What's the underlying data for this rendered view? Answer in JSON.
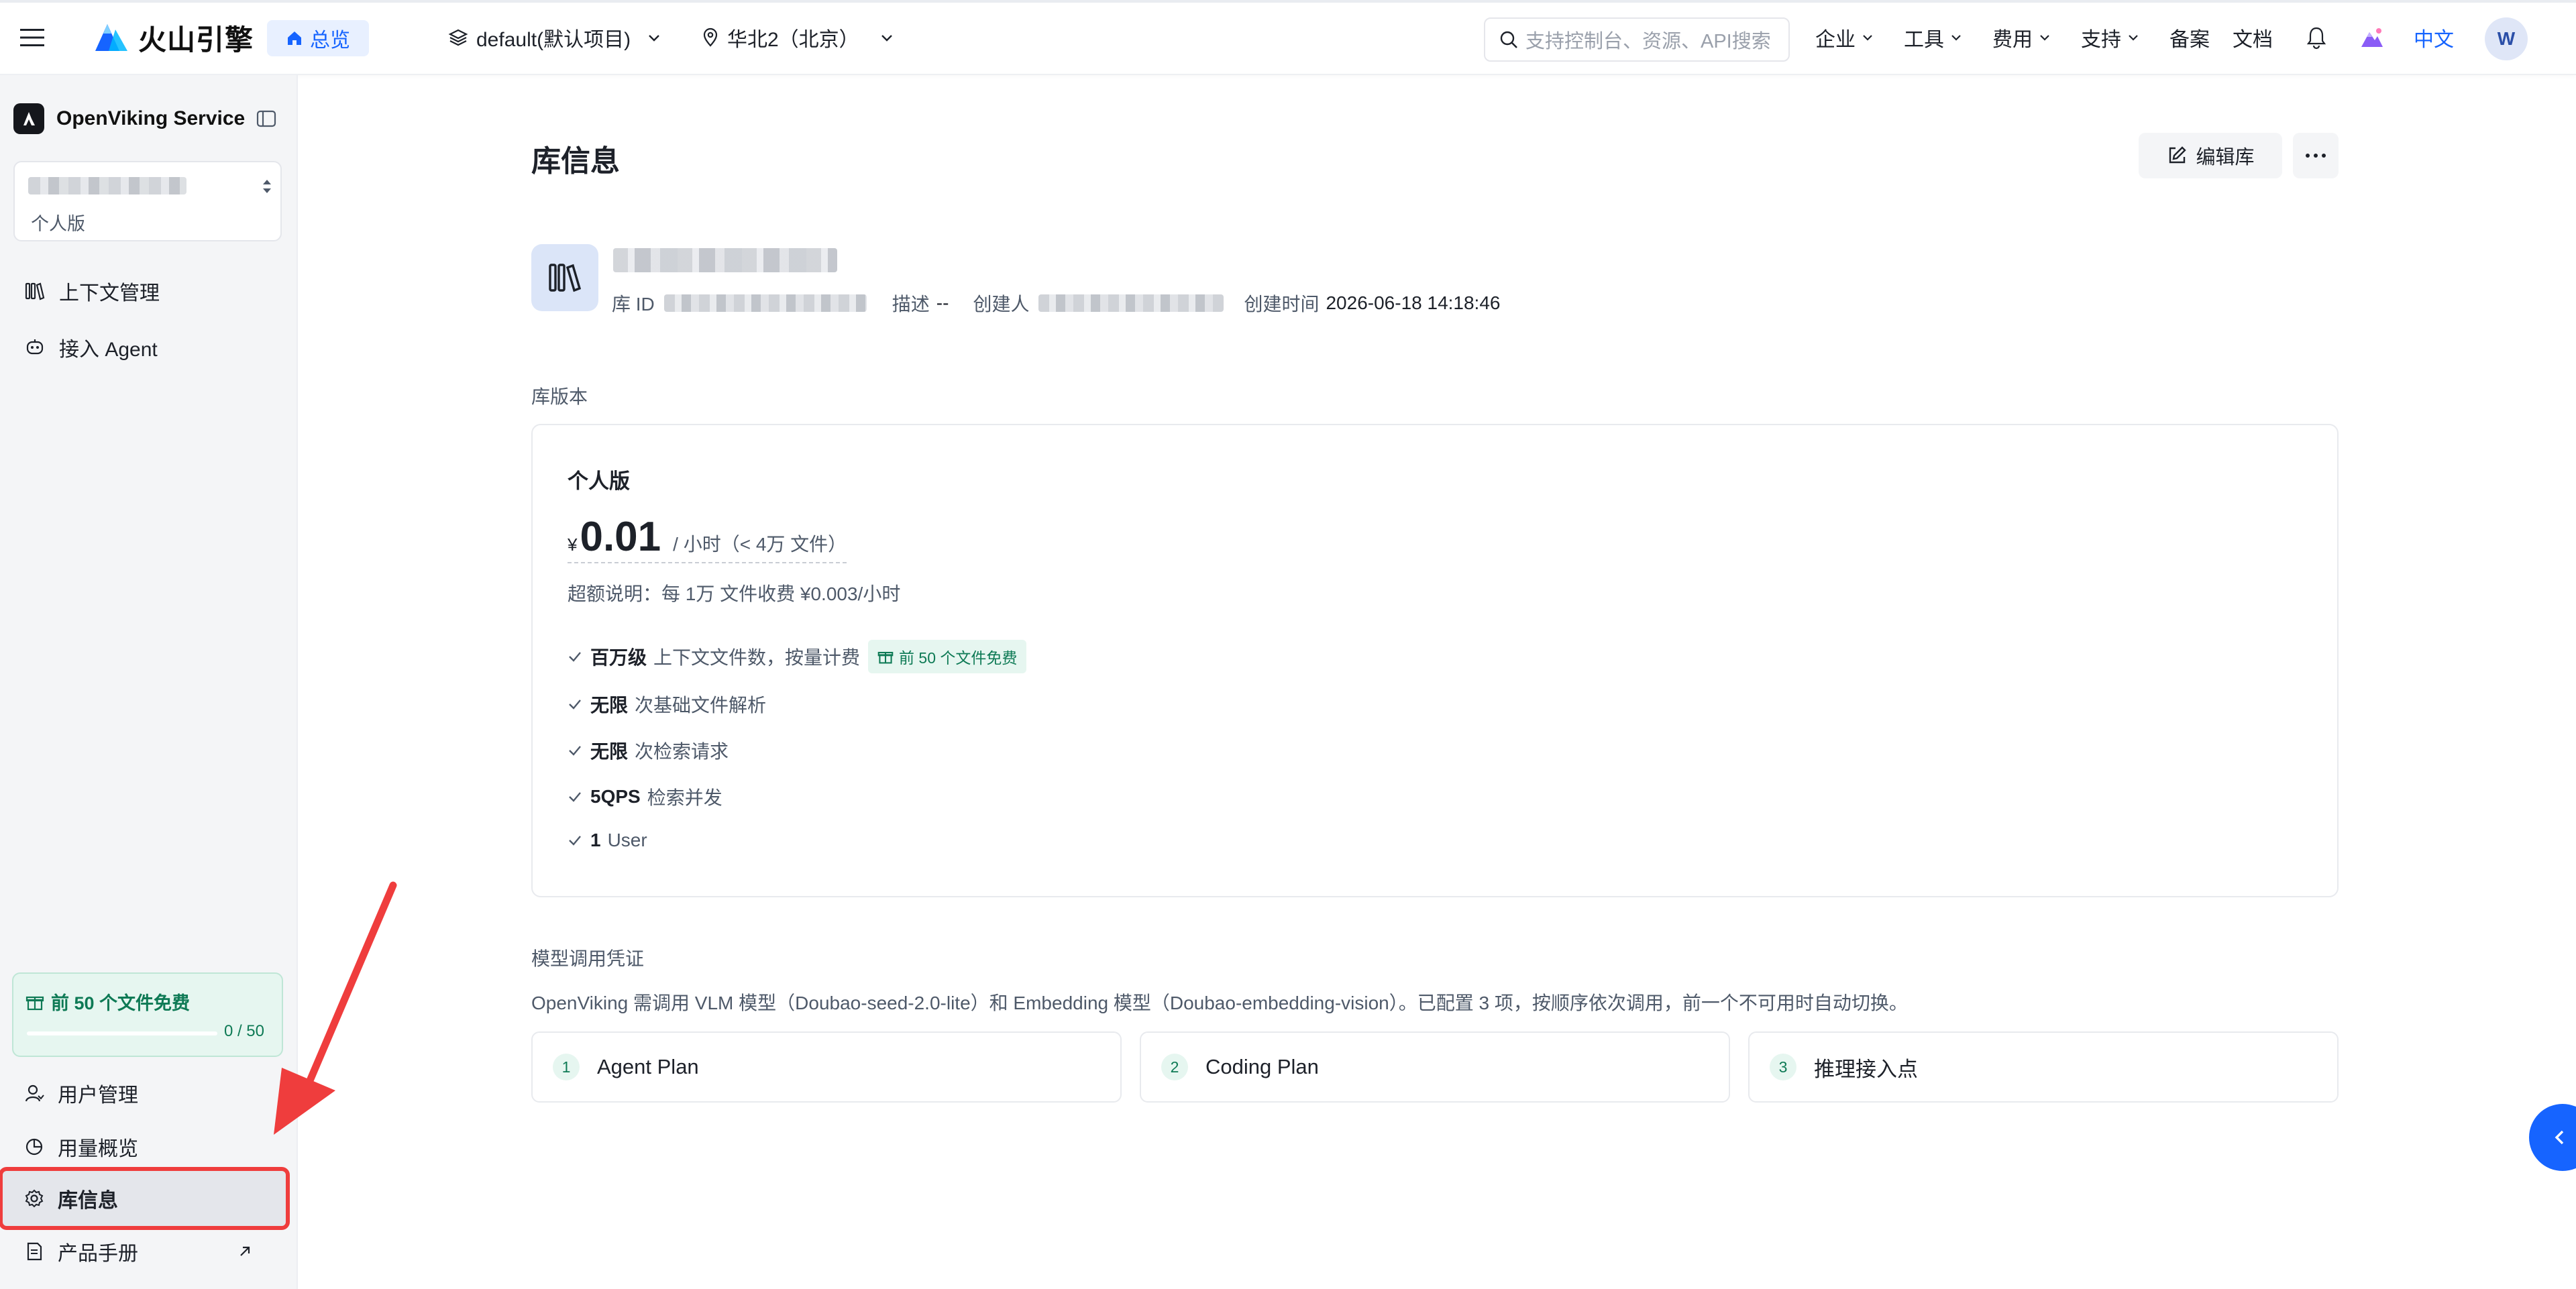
{
  "topbar": {
    "brand": "火山引擎",
    "overview": "总览",
    "project": "default(默认项目)",
    "region": "华北2（北京）",
    "search_placeholder": "支持控制台、资源、API搜索",
    "nav": [
      {
        "label": "企业",
        "has_dropdown": true
      },
      {
        "label": "工具",
        "has_dropdown": true
      },
      {
        "label": "费用",
        "has_dropdown": true
      },
      {
        "label": "支持",
        "has_dropdown": true
      },
      {
        "label": "备案",
        "has_dropdown": false
      },
      {
        "label": "文档",
        "has_dropdown": false
      }
    ],
    "language": "中文",
    "avatar_initial": "W"
  },
  "sidebar": {
    "service_name": "OpenViking Service",
    "workspace_plan": "个人版",
    "items_top": [
      {
        "label": "上下文管理",
        "icon": "library-icon"
      },
      {
        "label": "接入 Agent",
        "icon": "agent-icon"
      }
    ],
    "free_card": {
      "title": "前 50 个文件免费",
      "count": "0 / 50",
      "progress": 0
    },
    "items_bottom": [
      {
        "label": "用户管理",
        "icon": "user-icon"
      },
      {
        "label": "用量概览",
        "icon": "chart-icon"
      },
      {
        "label": "库信息",
        "icon": "gear-icon",
        "active": true
      },
      {
        "label": "产品手册",
        "icon": "doc-icon",
        "external": true
      }
    ]
  },
  "main": {
    "page_title": "库信息",
    "edit_button": "编辑库",
    "library": {
      "id_label": "库 ID",
      "desc_label": "描述",
      "desc_value": "--",
      "creator_label": "创建人",
      "created_label": "创建时间",
      "created_value": "2026-06-18 14:18:46"
    },
    "edition_section_label": "库版本",
    "plan": {
      "name": "个人版",
      "currency": "¥",
      "price": "0.01",
      "unit": "/ 小时（< 4万 文件）",
      "overage": "超额说明：每 1万 文件收费 ¥0.003/小时",
      "features": [
        {
          "bold": "百万级",
          "text": "上下文文件数，按量计费",
          "tag": "前 50 个文件免费"
        },
        {
          "bold": "无限",
          "text": "次基础文件解析",
          "tag": ""
        },
        {
          "bold": "无限",
          "text": "次检索请求",
          "tag": ""
        },
        {
          "bold": "5QPS",
          "text": "检索并发",
          "tag": ""
        },
        {
          "bold": "1",
          "text": "User",
          "tag": ""
        }
      ]
    },
    "credentials": {
      "label": "模型调用凭证",
      "desc": "OpenViking 需调用 VLM 模型（Doubao-seed-2.0-lite）和 Embedding 模型（Doubao-embedding-vision）。已配置 3 项，按顺序依次调用，前一个不可用时自动切换。",
      "items": [
        {
          "num": "1",
          "label": "Agent Plan"
        },
        {
          "num": "2",
          "label": "Coding Plan"
        },
        {
          "num": "3",
          "label": "推理接入点"
        }
      ]
    }
  },
  "colors": {
    "accent": "#1664ff",
    "highlight": "#ef3d3d",
    "success": "#0e7a55"
  }
}
